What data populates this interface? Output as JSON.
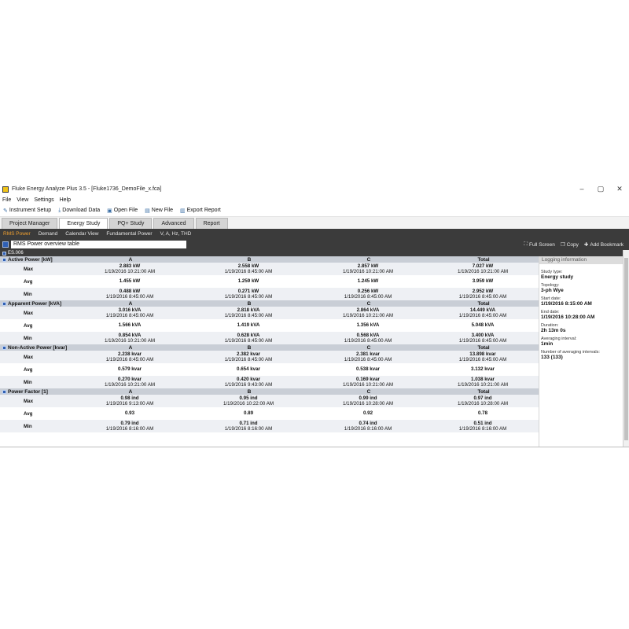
{
  "window": {
    "title": "Fluke Energy Analyze Plus 3.5 - [Fluke1736_DemoFile_x.fca]",
    "controls": [
      "–",
      "▢",
      "✕"
    ]
  },
  "menu": [
    "File",
    "View",
    "Settings",
    "Help"
  ],
  "toolbar": [
    {
      "label": "Instrument Setup",
      "icon": "wrench-icon",
      "glyph": "✎"
    },
    {
      "label": "Download Data",
      "icon": "download-icon",
      "glyph": "⤓"
    },
    {
      "label": "Open File",
      "icon": "folder-icon",
      "glyph": "▣"
    },
    {
      "label": "New File",
      "icon": "new-file-icon",
      "glyph": "▤"
    },
    {
      "label": "Export Report",
      "icon": "export-icon",
      "glyph": "▥"
    }
  ],
  "main_tabs": [
    "Project Manager",
    "Energy Study",
    "PQ+ Study",
    "Advanced",
    "Report"
  ],
  "main_tab_active": 1,
  "sub_tabs": [
    "RMS Power",
    "Demand",
    "Calendar View",
    "Fundamental Power",
    "V, A, Hz, THD"
  ],
  "sub_tab_active": 0,
  "view": {
    "selected": "RMS Power overview table",
    "actions": [
      {
        "label": "Full Screen",
        "icon": "fullscreen-icon",
        "glyph": "⛶"
      },
      {
        "label": "Copy",
        "icon": "copy-icon",
        "glyph": "❐"
      },
      {
        "label": "Add Bookmark",
        "icon": "bookmark-icon",
        "glyph": "✚"
      }
    ]
  },
  "study_id": "ES.006",
  "sections": [
    {
      "title": "Active Power [kW]",
      "columns": [
        "A",
        "B",
        "C",
        "Total"
      ],
      "rows": [
        {
          "label": "Max",
          "cells": [
            [
              "2.883 kW",
              "1/19/2016 10:21:00 AM"
            ],
            [
              "2.558 kW",
              "1/19/2016 8:45:00 AM"
            ],
            [
              "2.857 kW",
              "1/19/2016 10:21:00 AM"
            ],
            [
              "7.027 kW",
              "1/19/2016 10:21:00 AM"
            ]
          ]
        },
        {
          "label": "Avg",
          "cells": [
            [
              "1.455 kW"
            ],
            [
              "1.259 kW"
            ],
            [
              "1.245 kW"
            ],
            [
              "3.959 kW"
            ]
          ]
        },
        {
          "label": "Min",
          "cells": [
            [
              "0.488 kW",
              "1/19/2016 8:45:00 AM"
            ],
            [
              "0.271 kW",
              "1/19/2016 8:45:00 AM"
            ],
            [
              "0.256 kW",
              "1/19/2016 8:45:00 AM"
            ],
            [
              "2.952 kW",
              "1/19/2016 8:45:00 AM"
            ]
          ]
        }
      ]
    },
    {
      "title": "Apparent Power [kVA]",
      "columns": [
        "A",
        "B",
        "C",
        "Total"
      ],
      "rows": [
        {
          "label": "Max",
          "cells": [
            [
              "3.016 kVA",
              "1/19/2016 8:45:00 AM"
            ],
            [
              "2.818 kVA",
              "1/19/2016 8:45:00 AM"
            ],
            [
              "2.864 kVA",
              "1/19/2016 10:21:00 AM"
            ],
            [
              "14.449 kVA",
              "1/19/2016 8:45:00 AM"
            ]
          ]
        },
        {
          "label": "Avg",
          "cells": [
            [
              "1.566 kVA"
            ],
            [
              "1.419 kVA"
            ],
            [
              "1.356 kVA"
            ],
            [
              "5.048 kVA"
            ]
          ]
        },
        {
          "label": "Min",
          "cells": [
            [
              "0.854 kVA",
              "1/19/2016 10:21:00 AM"
            ],
            [
              "0.628 kVA",
              "1/19/2016 8:45:00 AM"
            ],
            [
              "0.568 kVA",
              "1/19/2016 8:45:00 AM"
            ],
            [
              "3.400 kVA",
              "1/19/2016 8:45:00 AM"
            ]
          ]
        }
      ]
    },
    {
      "title": "Non-Active Power [kvar]",
      "columns": [
        "A",
        "B",
        "C",
        "Total"
      ],
      "rows": [
        {
          "label": "Max",
          "cells": [
            [
              "2.238 kvar",
              "1/19/2016 8:45:00 AM"
            ],
            [
              "2.382 kvar",
              "1/19/2016 8:45:00 AM"
            ],
            [
              "2.381 kvar",
              "1/19/2016 8:45:00 AM"
            ],
            [
              "13.898 kvar",
              "1/19/2016 8:45:00 AM"
            ]
          ]
        },
        {
          "label": "Avg",
          "cells": [
            [
              "0.579 kvar"
            ],
            [
              "0.654 kvar"
            ],
            [
              "0.538 kvar"
            ],
            [
              "3.132 kvar"
            ]
          ]
        },
        {
          "label": "Min",
          "cells": [
            [
              "0.270 kvar",
              "1/19/2016 10:21:00 AM"
            ],
            [
              "0.420 kvar",
              "1/19/2016 9:43:00 AM"
            ],
            [
              "0.169 kvar",
              "1/19/2016 10:21:00 AM"
            ],
            [
              "1.038 kvar",
              "1/19/2016 10:21:00 AM"
            ]
          ]
        }
      ]
    },
    {
      "title": "Power Factor [1]",
      "columns": [
        "A",
        "B",
        "C",
        "Total"
      ],
      "rows": [
        {
          "label": "Max",
          "cells": [
            [
              "0.98 ind",
              "1/19/2016 9:13:00 AM"
            ],
            [
              "0.95 ind",
              "1/19/2016 10:22:00 AM"
            ],
            [
              "0.99 ind",
              "1/19/2016 10:28:00 AM"
            ],
            [
              "0.97 ind",
              "1/19/2016 10:28:00 AM"
            ]
          ]
        },
        {
          "label": "Avg",
          "cells": [
            [
              "0.93"
            ],
            [
              "0.89"
            ],
            [
              "0.92"
            ],
            [
              "0.78"
            ]
          ]
        },
        {
          "label": "Min",
          "cells": [
            [
              "0.79 ind",
              "1/19/2016 8:16:00 AM"
            ],
            [
              "0.71 ind",
              "1/19/2016 8:16:00 AM"
            ],
            [
              "0.74 ind",
              "1/19/2016 8:16:00 AM"
            ],
            [
              "0.51 ind",
              "1/19/2016 8:16:00 AM"
            ]
          ]
        }
      ]
    }
  ],
  "logging_info": {
    "header": "Logging information",
    "items": [
      {
        "label": "Study type:",
        "value": "Energy study"
      },
      {
        "label": "Topology:",
        "value": "3-ph Wye"
      },
      {
        "label": "Start date:",
        "value": "1/19/2016 8:15:00 AM"
      },
      {
        "label": "End date:",
        "value": "1/19/2016 10:28:00 AM"
      },
      {
        "label": "Duration:",
        "value": "2h 13m 0s"
      },
      {
        "label": "Averaging interval:",
        "value": "1min"
      },
      {
        "label": "Number of averaging intervals:",
        "value": "133 (133)"
      }
    ]
  }
}
